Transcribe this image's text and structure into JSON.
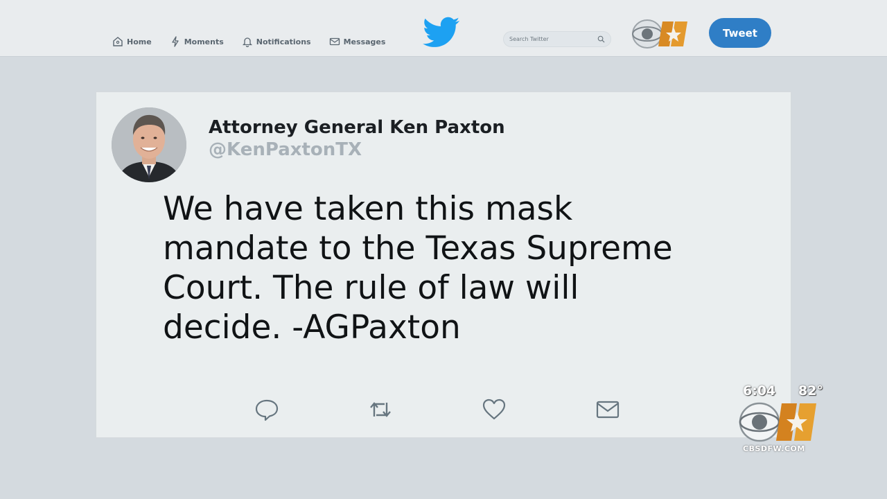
{
  "nav": {
    "items": [
      {
        "label": "Home",
        "icon": "home-icon"
      },
      {
        "label": "Moments",
        "icon": "lightning-icon"
      },
      {
        "label": "Notifications",
        "icon": "bell-icon"
      },
      {
        "label": "Messages",
        "icon": "envelope-icon"
      }
    ]
  },
  "search": {
    "placeholder": "Search Twitter"
  },
  "header": {
    "tweet_button": "Tweet"
  },
  "tweet": {
    "author_name": "Attorney General Ken Paxton",
    "handle": "@KenPaxtonTX",
    "lines": [
      "We have taken this mask",
      "mandate to the Texas Supreme",
      "Court. The rule of law will",
      "decide. -AGPaxton"
    ],
    "actions": [
      "reply-icon",
      "retweet-icon",
      "like-icon",
      "direct-message-icon"
    ]
  },
  "bug": {
    "time": "6:04",
    "temperature": "82°",
    "site": "CBSDFW.COM"
  },
  "colors": {
    "accent": "#2f7ec6",
    "twitter_blue": "#1da1f2",
    "background": "#d4dadf",
    "card": "#eaeeef"
  }
}
